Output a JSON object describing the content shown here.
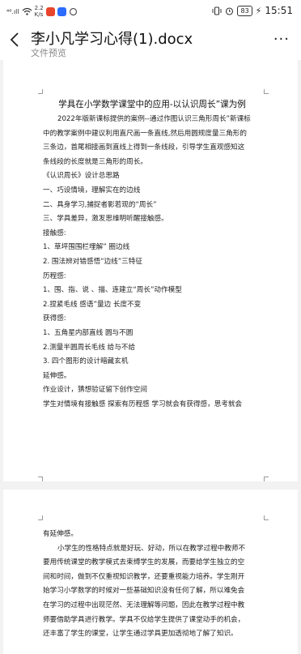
{
  "status": {
    "carrier": "⁴⁶.ıll",
    "speed_top": "2.2",
    "speed_bottom": "K/s",
    "battery": "83",
    "time": "15:51"
  },
  "header": {
    "title": "李小凡学习心得(1).docx",
    "subtitle": "文件预览",
    "more": "···"
  },
  "page1": {
    "title": "学具在小学数学课堂中的应用-以认识周长”课为例",
    "lines": [
      "2022年版新课标提供的案例--通过作图认识三角形周长”新课标",
      "中的教学案例中建议利用直尺画一条直线,然后用圆规度量三角形的",
      "三条边，首尾相接画到直线上得到一条线段，引导学生直观感知这",
      "条线段的长度就是三角形的周长。",
      "《认识周长》设计总思路",
      "一、巧设情境，理解实在的边线",
      "二、具身学习,捕捉者影若现的“周长”",
      "三、学具差异，激发思维明听醒接触感。",
      "接触感:",
      "1、草坪围围栏埋解” 圈边线",
      "2. 围法辨对错感悟“边线”三特征",
      "历程感:",
      "1、围、指、说 、描、连建立“周长”动作模型",
      "2.捏紧毛线 感语”量边 长度不变",
      "获得感:",
      "1、五角星内部直线  圆与不圆",
      "2.测量半圆周长毛线  给与不给",
      "3. 四个图形的设计暗藏玄机",
      "延伸感。",
      "作业设计，猜想验证留下创作空间",
      "学生对情境有接触感   探索有历程感   学习就会有获得感，思考就会"
    ]
  },
  "page2": {
    "lines": [
      "有延伸感。",
      "小学生的性格特点就是好玩、好动，所以在教学过程中教师不",
      "要用传统课堂的教学模式去束缚学生的发展，而要给学生独立的空",
      "间和时间，做到不仅重视知识教学，还要重视能力培养。学生刚开",
      "始学习小学数学的时候对一些基础知识没有任何了解，所以难免会",
      "在学习的过程中出现茫然、无法理解等问题，因此在教学过程中教",
      "师要借助学具进行教学。学具不仅给学生提供了课堂动手的机会，",
      "还丰富了学生的课堂，让学生通过学具更加透彻地了解了知识。"
    ]
  }
}
